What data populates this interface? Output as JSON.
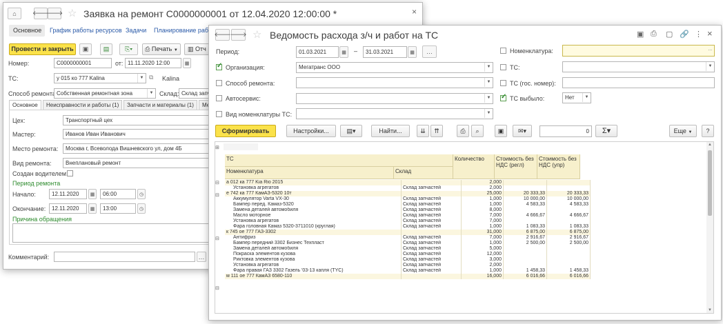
{
  "w1": {
    "title": "Заявка на ремонт С0000000001 от 12.04.2020 12:00:00 *",
    "tabs": [
      "Основное",
      "График работы ресурсов",
      "Задачи",
      "Планирование работ"
    ],
    "btn_post": "Провести и закрыть",
    "btn_print": "Печать",
    "btn_more": "Отч",
    "lbl_number": "Номер:",
    "number": "С0000000001",
    "lbl_from": "от:",
    "date": "11.11.2020 12:00",
    "lbl_ts": "ТС:",
    "ts": "у 015 ко 777 Kalina",
    "ts2": "Kalina",
    "lbl_method": "Способ ремонта:",
    "method": "Собственная ремонтная зона",
    "lbl_wh": "Склад:",
    "wh": "Склад запча",
    "subtabs": [
      "Основное",
      "Неисправности и работы (1)",
      "Запчасти и материалы (1)",
      "Ме"
    ],
    "lbl_shop": "Цех:",
    "shop": "Транспортный цех",
    "lbl_master": "Мастер:",
    "master": "Иванов Иван Иванович",
    "lbl_place": "Место ремонта:",
    "place": "Москва г, Всеволода Вишневского ул, дом 4Б",
    "lbl_kind": "Вид ремонта:",
    "kind": "Внеплановый ремонт",
    "lbl_driver": "Создан водителем:",
    "period_title": "Период ремонта",
    "lbl_start": "Начало:",
    "start_date": "12.11.2020",
    "start_time": "06:00",
    "lbl_end": "Окончание:",
    "end_date": "12.11.2020",
    "end_time": "13:00",
    "reason_title": "Причина обращения",
    "lbl_comment": "Комментарий:"
  },
  "w2": {
    "title": "Ведомость расхода з/ч и работ на ТС",
    "lbl_period": "Период:",
    "date_from": "01.03.2021",
    "date_to": "31.03.2021",
    "lbl_org": "Организация:",
    "org": "Мегатранс ООО",
    "lbl_method": "Способ ремонта:",
    "lbl_service": "Автосервис:",
    "lbl_nomtype": "Вид номенклатуры ТС:",
    "lbl_nom": "Номенклатура:",
    "lbl_ts": "ТС:",
    "lbl_tsgos": "ТС (гос. номер):",
    "lbl_tsout": "ТС выбыло:",
    "tsout_val": "Нет",
    "btn_form": "Сформировать",
    "btn_settings": "Настройки...",
    "btn_find": "Найти...",
    "sum_val": "0",
    "btn_more": "Еще",
    "btn_help": "?",
    "hdr_ts": "ТС",
    "hdr_nom": "Номенклатура",
    "hdr_wh": "Склад",
    "hdr_qty": "Количество",
    "hdr_cost1": "Стоимость без НДС (регл)",
    "hdr_cost2": "Стоимость без НДС (упр)",
    "rows": [
      {
        "t": "g",
        "n": "а 012 ка 777 Kia Rio 2015",
        "w": "",
        "q": "2,000",
        "c1": "",
        "c2": ""
      },
      {
        "t": "d",
        "n": "Установка агрегатов",
        "w": "Склад запчастей",
        "q": "2,000",
        "c1": "",
        "c2": ""
      },
      {
        "t": "g",
        "n": "е 742 ка 777 КамАЗ-5320 10т",
        "w": "",
        "q": "25,000",
        "c1": "20 333,33",
        "c2": "20 333,33"
      },
      {
        "t": "d",
        "n": "Аккумулятор Varta VX-30",
        "w": "Склад запчастей",
        "q": "1,000",
        "c1": "10 000,00",
        "c2": "10 000,00"
      },
      {
        "t": "d",
        "n": "Бампер перед. Камаз-5320",
        "w": "Склад запчастей",
        "q": "1,000",
        "c1": "4 583,33",
        "c2": "4 583,33"
      },
      {
        "t": "d",
        "n": "Замена деталей автомобиля",
        "w": "Склад запчастей",
        "q": "8,000",
        "c1": "",
        "c2": ""
      },
      {
        "t": "d",
        "n": "Масло моторное",
        "w": "Склад запчастей",
        "q": "7,000",
        "c1": "4 666,67",
        "c2": "4 666,67"
      },
      {
        "t": "d",
        "n": "Установка агрегатов",
        "w": "Склад запчастей",
        "q": "7,000",
        "c1": "",
        "c2": ""
      },
      {
        "t": "d",
        "n": "Фара головная Камаз 5320-3711010 (круглая)",
        "w": "Склад запчастей",
        "q": "1,000",
        "c1": "1 083,33",
        "c2": "1 083,33"
      },
      {
        "t": "g",
        "n": "к 745 ое 777 ГАЗ-3302",
        "w": "",
        "q": "31,000",
        "c1": "6 875,00",
        "c2": "6 875,00"
      },
      {
        "t": "d",
        "n": "Антифриз",
        "w": "Склад запчастей",
        "q": "7,000",
        "c1": "2 916,67",
        "c2": "2 916,67"
      },
      {
        "t": "d",
        "n": "Бампер передний 3302 Бизнес Техпласт",
        "w": "Склад запчастей",
        "q": "1,000",
        "c1": "2 500,00",
        "c2": "2 500,00"
      },
      {
        "t": "d",
        "n": "Замена деталей автомобиля",
        "w": "Склад запчастей",
        "q": "5,000",
        "c1": "",
        "c2": ""
      },
      {
        "t": "d",
        "n": "Покраска элементов кузова",
        "w": "Склад запчастей",
        "q": "12,000",
        "c1": "",
        "c2": ""
      },
      {
        "t": "d",
        "n": "Риктовка элементов кузова",
        "w": "Склад запчастей",
        "q": "3,000",
        "c1": "",
        "c2": ""
      },
      {
        "t": "d",
        "n": "Установка агрегатов",
        "w": "Склад запчастей",
        "q": "2,000",
        "c1": "",
        "c2": ""
      },
      {
        "t": "d",
        "n": "Фара правая ГАЗ 3302 Газель '03-13 капля (TYC)",
        "w": "Склад запчастей",
        "q": "1,000",
        "c1": "1 458,33",
        "c2": "1 458,33"
      },
      {
        "t": "g",
        "n": "м 111 ое 777 КамАЗ 6580-110",
        "w": "",
        "q": "16,000",
        "c1": "6 016,66",
        "c2": "6 016,66"
      }
    ]
  }
}
